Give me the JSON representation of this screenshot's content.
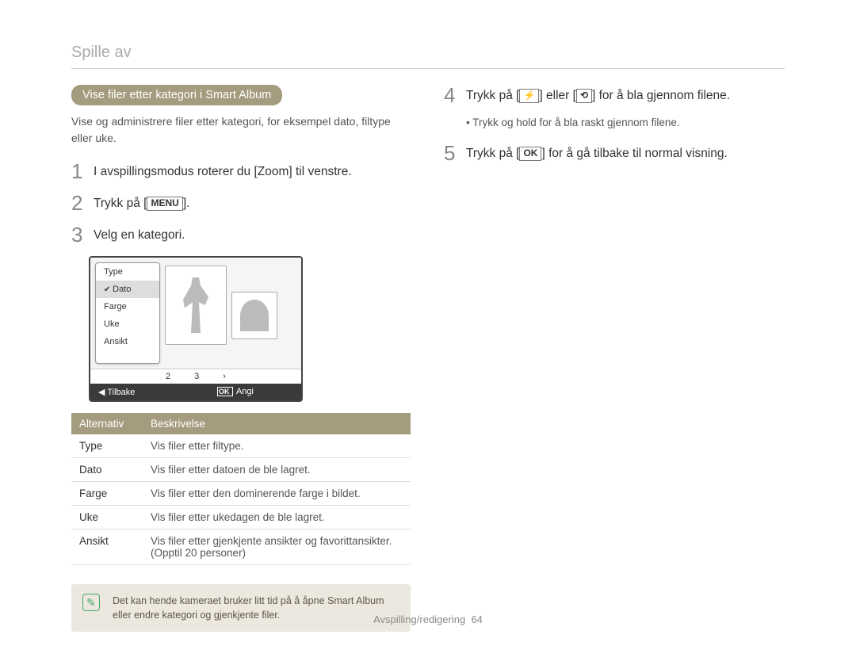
{
  "page_title": "Spille av",
  "left": {
    "heading_pill": "Vise filer etter kategori i Smart Album",
    "intro": "Vise og administrere filer etter kategori, for eksempel dato, filtype eller uke.",
    "step1": "I avspillingsmodus roterer du [Zoom] til venstre.",
    "step2_a": "Trykk på [",
    "step2_btn": "MENU",
    "step2_b": "].",
    "step3": "Velg en kategori.",
    "lcd": {
      "menu": [
        "Type",
        "Dato",
        "Farge",
        "Uke",
        "Ansikt"
      ],
      "selected_index": 1,
      "pager": [
        "2",
        "3",
        "›"
      ],
      "bar_back": "Tilbake",
      "bar_set": "Angi"
    },
    "table": {
      "head": [
        "Alternativ",
        "Beskrivelse"
      ],
      "rows": [
        [
          "Type",
          "Vis filer etter filtype."
        ],
        [
          "Dato",
          "Vis filer etter datoen de ble lagret."
        ],
        [
          "Farge",
          "Vis filer etter den dominerende farge i bildet."
        ],
        [
          "Uke",
          "Vis filer etter ukedagen de ble lagret."
        ],
        [
          "Ansikt",
          "Vis filer etter gjenkjente ansikter og favorittansikter. (Opptil 20 personer)"
        ]
      ]
    },
    "note": "Det kan hende kameraet bruker litt tid på å åpne Smart Album eller endre kategori og gjenkjente filer."
  },
  "right": {
    "step4_a": "Trykk på [",
    "step4_icon1": "⚡",
    "step4_mid": "] eller [",
    "step4_icon2": "⟲",
    "step4_b": "] for å bla gjennom filene.",
    "step4_sub": "Trykk og hold for å bla raskt gjennom filene.",
    "step5_a": "Trykk på [",
    "step5_btn": "OK",
    "step5_b": "] for å gå tilbake til normal visning."
  },
  "footer_label": "Avspilling/redigering",
  "footer_page": "64"
}
